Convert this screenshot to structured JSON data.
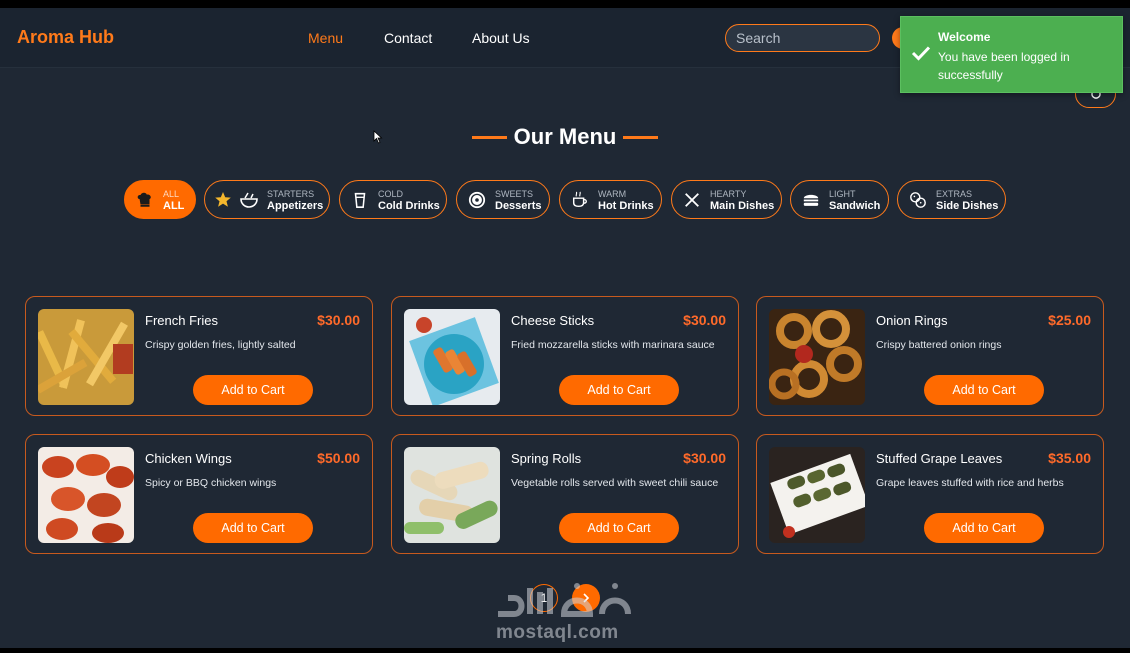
{
  "header": {
    "brand": "Aroma Hub",
    "nav": [
      {
        "label": "Menu",
        "active": true
      },
      {
        "label": "Contact",
        "active": false
      },
      {
        "label": "About Us",
        "active": false
      }
    ],
    "search_placeholder": "Search"
  },
  "toast": {
    "title": "Welcome",
    "message": "You have been logged in successfully",
    "color": "#4caf50"
  },
  "page_title": "Our Menu",
  "categories": [
    {
      "small": "ALL",
      "label": "ALL",
      "icon": "chef-hat-icon",
      "active": true
    },
    {
      "small": "STARTERS",
      "label": "Appetizers",
      "icon": "star-bowl-icon",
      "active": false
    },
    {
      "small": "COLD",
      "label": "Cold Drinks",
      "icon": "cup-icon",
      "active": false
    },
    {
      "small": "SWEETS",
      "label": "Desserts",
      "icon": "donut-icon",
      "active": false
    },
    {
      "small": "WARM",
      "label": "Hot Drinks",
      "icon": "mug-icon",
      "active": false
    },
    {
      "small": "HEARTY",
      "label": "Main Dishes",
      "icon": "cutlery-icon",
      "active": false
    },
    {
      "small": "LIGHT",
      "label": "Sandwich",
      "icon": "burger-icon",
      "active": false
    },
    {
      "small": "EXTRAS",
      "label": "Side Dishes",
      "icon": "cookies-icon",
      "active": false
    }
  ],
  "items": [
    {
      "name": "French Fries",
      "price": "$30.00",
      "desc": "Crispy golden fries, lightly salted",
      "button": "Add to Cart"
    },
    {
      "name": "Cheese Sticks",
      "price": "$30.00",
      "desc": "Fried mozzarella sticks with marinara sauce",
      "button": "Add to Cart"
    },
    {
      "name": "Onion Rings",
      "price": "$25.00",
      "desc": "Crispy battered onion rings",
      "button": "Add to Cart"
    },
    {
      "name": "Chicken Wings",
      "price": "$50.00",
      "desc": "Spicy or BBQ chicken wings",
      "button": "Add to Cart"
    },
    {
      "name": "Spring Rolls",
      "price": "$30.00",
      "desc": "Vegetable rolls served with sweet chili sauce",
      "button": "Add to Cart"
    },
    {
      "name": "Stuffed Grape Leaves",
      "price": "$35.00",
      "desc": "Grape leaves stuffed with rice and herbs",
      "button": "Add to Cart"
    }
  ],
  "pagination": {
    "current": "1"
  },
  "watermark": "mostaql.com",
  "colors": {
    "accent": "#ff6a00",
    "background": "#1f2834",
    "header": "#1b2430"
  }
}
